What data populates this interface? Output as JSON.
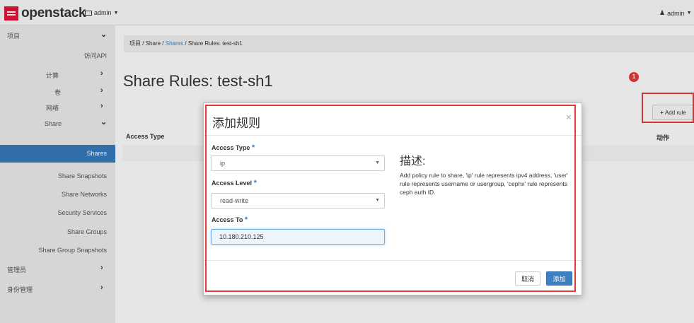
{
  "header": {
    "brand": "openstack",
    "project": "admin",
    "user": "admin"
  },
  "sidebar": {
    "items": [
      {
        "label": "项目"
      },
      {
        "label": "访问API"
      },
      {
        "label": "计算"
      },
      {
        "label": "卷"
      },
      {
        "label": "网络"
      },
      {
        "label": "Share"
      },
      {
        "label": "Shares"
      },
      {
        "label": "Share Snapshots"
      },
      {
        "label": "Share Networks"
      },
      {
        "label": "Security Services"
      },
      {
        "label": "Share Groups"
      },
      {
        "label": "Share Group Snapshots"
      },
      {
        "label": "管理员"
      },
      {
        "label": "身份管理"
      }
    ]
  },
  "breadcrumb": {
    "items": [
      "项目",
      "Share",
      "Shares",
      "Share Rules: test-sh1"
    ],
    "separator": "/"
  },
  "page": {
    "title": "Share Rules: test-sh1",
    "add_rule": "Add rule",
    "badge_count": "1"
  },
  "table": {
    "columns": [
      "Access Type",
      "动作"
    ]
  },
  "modal": {
    "title": "添加规则",
    "access_type_label": "Access Type",
    "access_type_value": "ip",
    "access_level_label": "Access Level",
    "access_level_value": "read-write",
    "access_to_label": "Access To",
    "access_to_value": "10.180.210.125",
    "required_mark": "*",
    "desc_title": "描述:",
    "desc_text": "Add policy rule to share, 'ip' rule represents ipv4 address, 'user' rule represents username or usergroup, 'cephx' rule represents ceph auth ID.",
    "cancel": "取消",
    "add": "添加",
    "close": "×"
  },
  "colors": {
    "primary": "#3a80c2",
    "annotation": "#e53935",
    "logo": "#e0143b"
  }
}
